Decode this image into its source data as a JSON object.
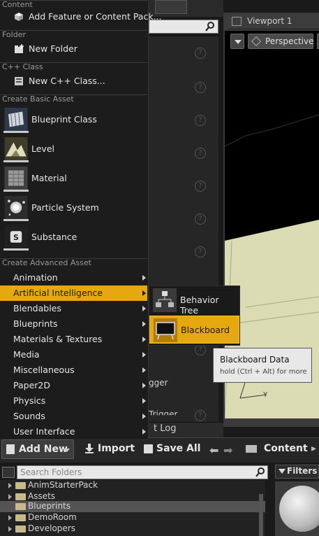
{
  "add_menu": {
    "sections": {
      "content": "Content",
      "folder": "Folder",
      "cpp": "C++ Class",
      "basic": "Create Basic Asset",
      "advanced": "Create Advanced Asset"
    },
    "add_feature": "Add Feature or Content Pack...",
    "new_folder": "New Folder",
    "new_cpp_class": "New C++ Class...",
    "basic_assets": [
      "Blueprint Class",
      "Level",
      "Material",
      "Particle System",
      "Substance"
    ],
    "advanced_assets": [
      "Animation",
      "Artificial Intelligence",
      "Blendables",
      "Blueprints",
      "Materials & Textures",
      "Media",
      "Miscellaneous",
      "Paper2D",
      "Physics",
      "Sounds",
      "User Interface"
    ],
    "highlighted_category": "Artificial Intelligence"
  },
  "submenu": {
    "items": [
      "Behavior Tree",
      "Blackboard"
    ],
    "highlighted": "Blackboard"
  },
  "tooltip": {
    "title": "Blackboard Data",
    "hint": "hold (Ctrl + Alt) for more"
  },
  "viewport": {
    "tab": "Viewport 1",
    "mode": "Perspective"
  },
  "background": {
    "partial_text_1": "gger",
    "partial_text_2": "Trigger",
    "log_tab": "t Log"
  },
  "content_browser": {
    "add_new": "Add New",
    "import": "Import",
    "save_all": "Save All",
    "path": "Content",
    "folder_search_placeholder": "Search Folders",
    "filters": "Filters",
    "folders": [
      "AnimStarterPack",
      "Assets",
      "Blueprints",
      "DemoRoom",
      "Developers"
    ],
    "selected_folder": "Blueprints"
  },
  "colors": {
    "highlight": "#e6a80f",
    "menu_bg": "#1c1c1c",
    "viewport_floor": "#dcdcb4"
  }
}
